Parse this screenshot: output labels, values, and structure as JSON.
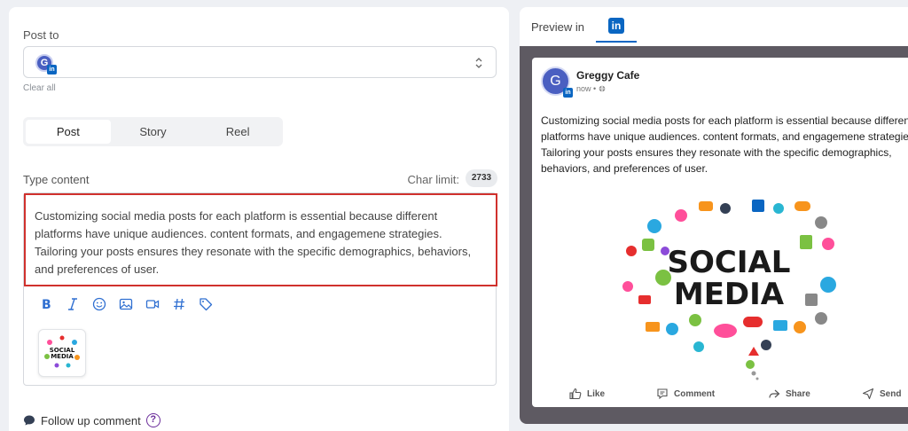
{
  "compose": {
    "post_to_label": "Post to",
    "avatar_initial": "G",
    "clear_all": "Clear all",
    "tabs": [
      {
        "label": "Post"
      },
      {
        "label": "Story"
      },
      {
        "label": "Reel"
      }
    ],
    "active_tab": "Post",
    "type_content_label": "Type content",
    "char_limit_label": "Char limit:",
    "char_limit_value": "2733",
    "content_lines": [
      "Customizing social media posts for each platform is essential because different",
      "platforms have unique audiences. content formats, and engagemene strategies.",
      "Tailoring your posts ensures they resonate with the specific demographics, behaviors,",
      "and preferences of user."
    ],
    "toolbar_icons": [
      "bold-icon",
      "italic-icon",
      "emoji-icon",
      "image-icon",
      "video-icon",
      "hashtag-icon",
      "tag-icon"
    ],
    "followup_label": "Follow up comment",
    "followup_help": "?"
  },
  "preview": {
    "label": "Preview in",
    "platform_logo": "in",
    "author_initial": "G",
    "author_name": "Greggy Cafe",
    "time": "now •",
    "text_lines": [
      "Customizing social media posts for each platform is essential because different",
      "platforms have unique audiences. content formats, and engagemene strategies.",
      "Tailoring your posts ensures they resonate with the specific demographics,",
      "behaviors, and preferences of user."
    ],
    "image_words": [
      "SOCIAL",
      "MEDIA"
    ],
    "actions": [
      {
        "label": "Like",
        "icon": "thumbs-up-icon"
      },
      {
        "label": "Comment",
        "icon": "comment-icon"
      },
      {
        "label": "Share",
        "icon": "share-icon"
      },
      {
        "label": "Send",
        "icon": "send-icon"
      }
    ]
  },
  "colors": {
    "linkedin": "#0a66c2",
    "error_border": "#d0312d",
    "toolbar_icon": "#2f6fd1",
    "avatar": "#4a5fc1"
  }
}
